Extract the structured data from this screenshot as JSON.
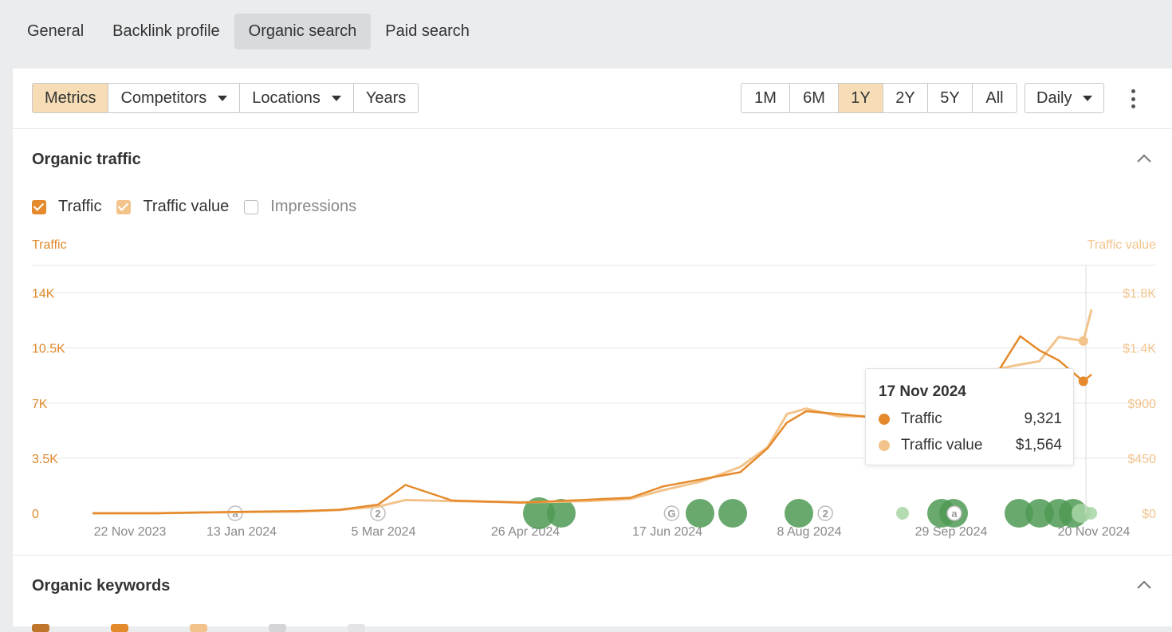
{
  "tabs": [
    {
      "label": "General",
      "active": false
    },
    {
      "label": "Backlink profile",
      "active": false
    },
    {
      "label": "Organic search",
      "active": true
    },
    {
      "label": "Paid search",
      "active": false
    }
  ],
  "toolbar": {
    "metrics": "Metrics",
    "competitors": "Competitors",
    "locations": "Locations",
    "years": "Years"
  },
  "ranges": [
    "1M",
    "6M",
    "1Y",
    "2Y",
    "5Y",
    "All"
  ],
  "active_range": "1Y",
  "interval": "Daily",
  "organic_traffic": {
    "title": "Organic traffic",
    "checkboxes": [
      {
        "label": "Traffic",
        "checked": true
      },
      {
        "label": "Traffic value",
        "checked": true
      },
      {
        "label": "Impressions",
        "checked": false
      }
    ]
  },
  "organic_keywords": {
    "title": "Organic keywords"
  },
  "colors": {
    "traffic": "#e58a2c",
    "traffic_value": "#f2c48c",
    "event_dark": "#4f9a55",
    "event_light": "#a8d5a4"
  },
  "tooltip": {
    "date": "17 Nov 2024",
    "rows": [
      {
        "label": "Traffic",
        "value": "9,321"
      },
      {
        "label": "Traffic value",
        "value": "$1,564"
      }
    ]
  },
  "chart_data": {
    "type": "line",
    "title": "Organic traffic",
    "ylabel": "Traffic",
    "y2label": "Traffic value",
    "ylim": [
      0,
      17500
    ],
    "y2lim": [
      0,
      2250
    ],
    "yticks": [
      "0",
      "3.5K",
      "7K",
      "10.5K",
      "14K"
    ],
    "y2ticks": [
      "$0",
      "$450",
      "$900",
      "$1.4K",
      "$1.8K"
    ],
    "xticks": [
      "22 Nov 2023",
      "13 Jan 2024",
      "5 Mar 2024",
      "26 Apr 2024",
      "17 Jun 2024",
      "8 Aug 2024",
      "29 Sep 2024",
      "20 Nov 2024"
    ],
    "x": [
      "2023-11-22",
      "2023-12-15",
      "2024-01-13",
      "2024-02-05",
      "2024-02-20",
      "2024-03-05",
      "2024-03-15",
      "2024-04-01",
      "2024-04-26",
      "2024-05-20",
      "2024-06-05",
      "2024-06-17",
      "2024-07-01",
      "2024-07-15",
      "2024-07-25",
      "2024-08-01",
      "2024-08-08",
      "2024-08-20",
      "2024-09-05",
      "2024-09-20",
      "2024-09-29",
      "2024-10-05",
      "2024-10-15",
      "2024-10-25",
      "2024-11-01",
      "2024-11-08",
      "2024-11-17",
      "2024-11-20"
    ],
    "series": [
      {
        "name": "Traffic",
        "axis": "left",
        "values": [
          0,
          0,
          100,
          150,
          250,
          600,
          2000,
          900,
          750,
          950,
          1100,
          1900,
          2400,
          2900,
          4600,
          6400,
          7200,
          7000,
          6700,
          6800,
          8800,
          10000,
          9400,
          12500,
          11500,
          10800,
          9321,
          9800
        ]
      },
      {
        "name": "Traffic value",
        "axis": "right",
        "values": [
          0,
          0,
          10,
          15,
          30,
          60,
          120,
          110,
          100,
          110,
          130,
          210,
          290,
          420,
          600,
          900,
          950,
          880,
          880,
          860,
          1050,
          1180,
          1300,
          1350,
          1380,
          1600,
          1564,
          1850
        ]
      }
    ],
    "events": [
      {
        "date": "2024-01-13",
        "label": "a"
      },
      {
        "date": "2024-03-05",
        "label": "2"
      },
      {
        "date": "2024-06-20",
        "label": "G"
      },
      {
        "date": "2024-08-15",
        "label": "2"
      },
      {
        "date": "2024-10-01",
        "label": "a"
      }
    ]
  }
}
